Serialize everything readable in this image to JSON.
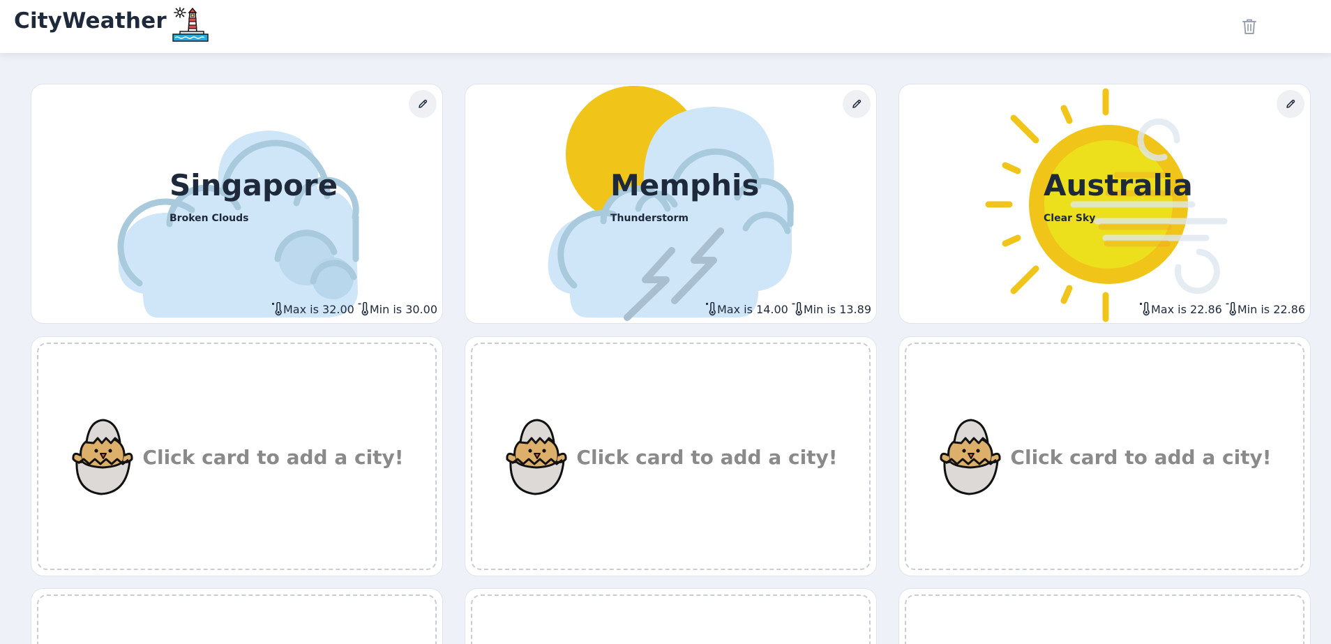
{
  "app": {
    "title": "CityWeather",
    "logo_icon": "lighthouse-icon",
    "clear_all_icon": "trash-icon"
  },
  "cities": [
    {
      "name": "Singapore",
      "description": "Broken Clouds",
      "max_label": "Max is 32.00",
      "min_label": "Min is 30.00",
      "weather_icon": "broken-clouds-icon"
    },
    {
      "name": "Memphis",
      "description": "Thunderstorm",
      "max_label": "Max is 14.00",
      "min_label": "Min is 13.89",
      "weather_icon": "thunderstorm-icon"
    },
    {
      "name": "Australia",
      "description": "Clear Sky",
      "max_label": "Max is 22.86",
      "min_label": "Min is 22.86",
      "weather_icon": "clear-sky-icon"
    }
  ],
  "empty_card": {
    "text": "Click card to add a city!",
    "icon": "hatching-chick-icon"
  },
  "colors": {
    "background": "#eef1f7",
    "text_dark": "#1e293b",
    "cloud_fill": "#cfe6f8",
    "cloud_stroke": "#a9cadd",
    "sun": "#f0c419",
    "placeholder_text": "#8a8a8a"
  }
}
